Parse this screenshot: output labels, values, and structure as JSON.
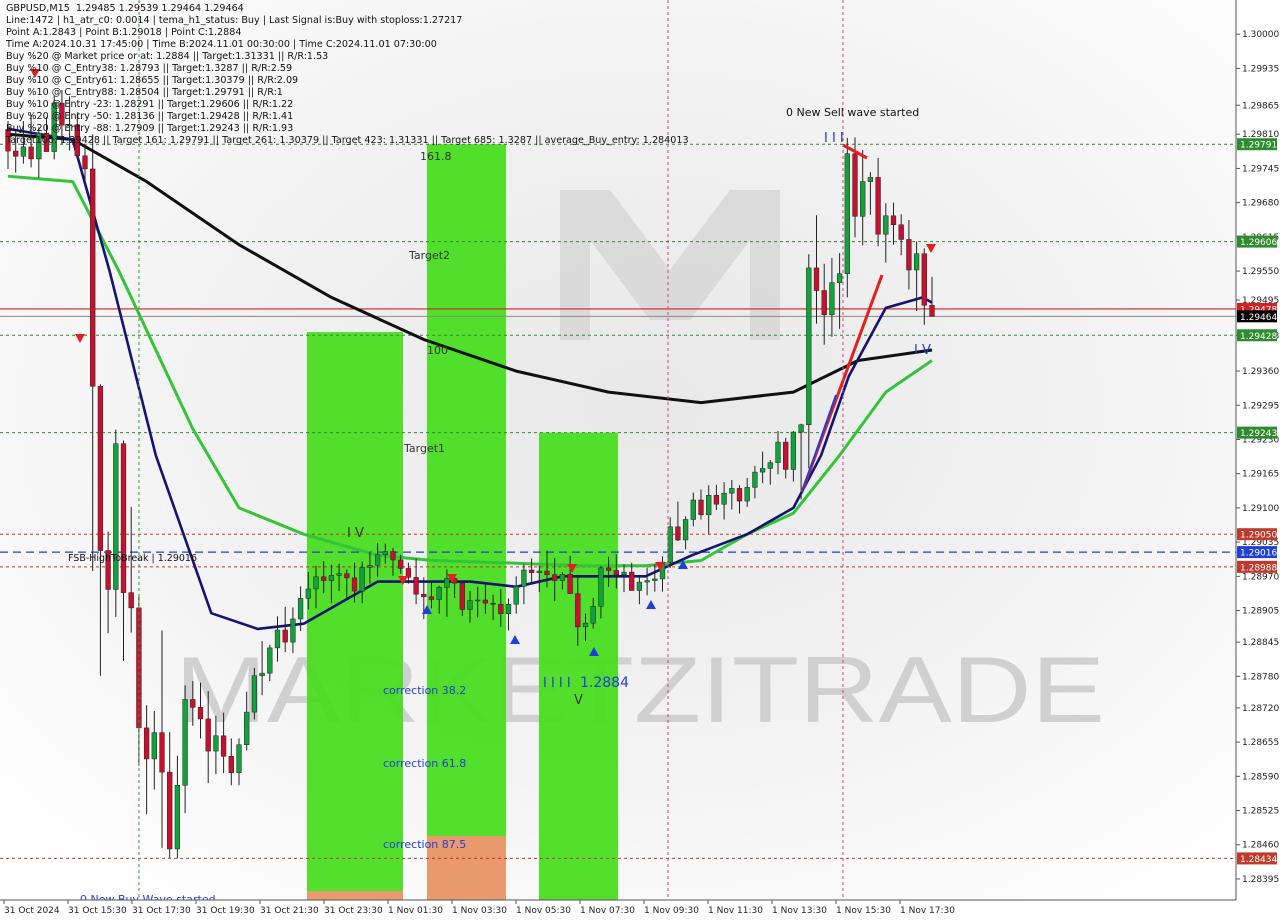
{
  "info_lines": [
    "GBPUSD,M15  1.29485 1.29539 1.29464 1.29464",
    "Line:1472 | h1_atr_c0: 0.0014 | tema_h1_status: Buy | Last Signal is:Buy with stoploss:1.27217",
    "Point A:1.2843 | Point B:1.29018 | Point C:1.2884",
    "Time A:2024.10.31 17:45:00 | Time B:2024.11.01 00:30:00 | Time C:2024.11.01 07:30:00",
    "Buy %20 @ Market price or at: 1.2884 || Target:1.31331 || R/R:1.53",
    "Buy %10 @ C_Entry38: 1.28793 || Target:1.3287 || R/R:2.59",
    "Buy %10 @ C_Entry61: 1.28655 || Target:1.30379 || R/R:2.09",
    "Buy %10 @ C_Entry88: 1.28504 || Target:1.29791 || R/R:1",
    "Buy %10 @ Entry -23: 1.28291 || Target:1.29606 || R/R:1.22",
    "Buy %20 @ Entry -50: 1.28136 || Target:1.29428 || R/R:1.41",
    "Buy %20 @ Entry -88: 1.27909 || Target:1.29243 || R/R:1.93",
    "Target100: 1.29428 || Target 161: 1.29791 || Target 261: 1.30379 || Target 423: 1.31331 || Target 685: 1.3287 || average_Buy_entry: 1.284013"
  ],
  "annotations": {
    "fsb_label": "FSB-HighToBreak | 1.29016",
    "new_sell_wave": "0 New Sell wave started",
    "new_buy_wave": "0 New Buy Wave started",
    "point_c_label": "1.2884",
    "roman_c": "I I I I",
    "roman_b": "I I I",
    "roman_v": "V",
    "roman_iv": "I V",
    "target2": "Target2",
    "target1": "Target1",
    "level_1618": "161.8",
    "level_100": "100",
    "correction_382": "correction 38.2",
    "correction_618": "correction 61.8",
    "correction_875": "correction 87.5",
    "watermark": "MARKETZITRADE"
  },
  "chart_data": {
    "type": "candlestick",
    "symbol": "GBPUSD",
    "timeframe": "M15",
    "last_price": 1.29464,
    "ylim": [
      1.28355,
      1.30065
    ],
    "y_ticks": [
      "1.30000",
      "1.29935",
      "1.29865",
      "1.29810",
      "1.29745",
      "1.29680",
      "1.29615",
      "1.29550",
      "1.29495",
      "1.29428",
      "1.29360",
      "1.29295",
      "1.29230",
      "1.29165",
      "1.29100",
      "1.29035",
      "1.28970",
      "1.28905",
      "1.28845",
      "1.28780",
      "1.28720",
      "1.28655",
      "1.28590",
      "1.28525",
      "1.28460",
      "1.28395"
    ],
    "x_labels": [
      "31 Oct 2024",
      "31 Oct 15:30",
      "31 Oct 17:30",
      "31 Oct 19:30",
      "31 Oct 21:30",
      "31 Oct 23:30",
      "1 Nov 01:30",
      "1 Nov 03:30",
      "1 Nov 05:30",
      "1 Nov 07:30",
      "1 Nov 09:30",
      "1 Nov 11:30",
      "1 Nov 13:30",
      "1 Nov 15:30",
      "1 Nov 17:30"
    ],
    "price_tags": [
      {
        "value": 1.29791,
        "text": "1.29791",
        "color": "#2e8b2e"
      },
      {
        "value": 1.29606,
        "text": "1.29606",
        "color": "#2e8b2e"
      },
      {
        "value": 1.29478,
        "text": "1.29478",
        "color": "#d42020"
      },
      {
        "value": 1.29464,
        "text": "1.29464",
        "color": "#000000"
      },
      {
        "value": 1.29428,
        "text": "1.29428",
        "color": "#2e8b2e"
      },
      {
        "value": 1.29243,
        "text": "1.29243",
        "color": "#2e8b2e"
      },
      {
        "value": 1.2905,
        "text": "1.29050",
        "color": "#c0392b"
      },
      {
        "value": 1.29016,
        "text": "1.29016",
        "color": "#1f3fd6"
      },
      {
        "value": 1.28988,
        "text": "1.28988",
        "color": "#c0392b"
      },
      {
        "value": 1.28434,
        "text": "1.28434",
        "color": "#c0392b"
      }
    ],
    "zones": [
      {
        "name": "zone-b",
        "x0": 307,
        "x1": 403,
        "top": 1.29434,
        "bottom": 1.2835,
        "color": "#44dd1a"
      },
      {
        "name": "zone-c",
        "x0": 427,
        "x1": 506,
        "top": 1.29791,
        "bottom": 1.2835,
        "color": "#44dd1a"
      },
      {
        "name": "zone-d",
        "x0": 539,
        "x1": 618,
        "top": 1.29243,
        "bottom": 1.2835,
        "color": "#44dd1a"
      }
    ],
    "colors": {
      "bull": "#11a33a",
      "bear": "#c8102e",
      "ema_black": "#111111",
      "ema_navy": "#141470",
      "ema_green": "#34c43a",
      "target_line": "#2e8b2e",
      "red_line": "#d42020",
      "blue_line": "#1f3fd6"
    },
    "candles": [
      [
        1.29819,
        1.29835,
        1.29744,
        1.29778
      ],
      [
        1.29778,
        1.29815,
        1.29737,
        1.29768
      ],
      [
        1.29768,
        1.29835,
        1.29754,
        1.29786
      ],
      [
        1.29786,
        1.29847,
        1.29747,
        1.29763
      ],
      [
        1.29763,
        1.29823,
        1.29727,
        1.29812
      ],
      [
        1.29812,
        1.29843,
        1.29786,
        1.29777
      ],
      [
        1.29777,
        1.29883,
        1.29762,
        1.29869
      ],
      [
        1.29869,
        1.29894,
        1.29791,
        1.29827
      ],
      [
        1.29827,
        1.29882,
        1.29779,
        1.29828
      ],
      [
        1.29828,
        1.29848,
        1.29789,
        1.29769
      ],
      [
        1.29769,
        1.29788,
        1.29722,
        1.29744
      ],
      [
        1.29744,
        1.2981,
        1.2898,
        1.29331
      ],
      [
        1.29331,
        1.29335,
        1.28781,
        1.29019
      ],
      [
        1.29019,
        1.29055,
        1.28862,
        1.28945
      ],
      [
        1.28945,
        1.29249,
        1.28893,
        1.29222
      ],
      [
        1.29222,
        1.29228,
        1.28809,
        1.28939
      ],
      [
        1.28939,
        1.29102,
        1.28863,
        1.2891
      ],
      [
        1.2891,
        1.28935,
        1.2861,
        1.28682
      ],
      [
        1.28682,
        1.28725,
        1.28518,
        1.28623
      ],
      [
        1.28623,
        1.28714,
        1.28565,
        1.28673
      ],
      [
        1.28673,
        1.28867,
        1.28454,
        1.28598
      ],
      [
        1.28598,
        1.28674,
        1.28435,
        1.28452
      ],
      [
        1.28452,
        1.28629,
        1.28434,
        1.28573
      ],
      [
        1.28573,
        1.28763,
        1.2852,
        1.28736
      ],
      [
        1.28736,
        1.28771,
        1.28686,
        1.28721
      ],
      [
        1.28721,
        1.28768,
        1.28662,
        1.28699
      ],
      [
        1.28699,
        1.28752,
        1.28577,
        1.28638
      ],
      [
        1.28638,
        1.28705,
        1.28594,
        1.28667
      ],
      [
        1.28667,
        1.28711,
        1.28596,
        1.28628
      ],
      [
        1.28628,
        1.28662,
        1.28573,
        1.28597
      ],
      [
        1.28597,
        1.28662,
        1.28573,
        1.2865
      ],
      [
        1.2865,
        1.28751,
        1.28639,
        1.28712
      ],
      [
        1.28712,
        1.28796,
        1.28698,
        1.28781
      ],
      [
        1.28781,
        1.28847,
        1.28744,
        1.28786
      ],
      [
        1.28786,
        1.2884,
        1.28771,
        1.28834
      ],
      [
        1.28834,
        1.28894,
        1.28808,
        1.28868
      ],
      [
        1.28868,
        1.28912,
        1.28826,
        1.28845
      ],
      [
        1.28845,
        1.28911,
        1.28824,
        1.28889
      ],
      [
        1.28889,
        1.28951,
        1.28866,
        1.28928
      ],
      [
        1.28928,
        1.28978,
        1.28907,
        1.28946
      ],
      [
        1.28946,
        1.2899,
        1.28909,
        1.28969
      ],
      [
        1.28969,
        1.28999,
        1.28938,
        1.28962
      ],
      [
        1.28962,
        1.28992,
        1.28919,
        1.28972
      ],
      [
        1.28972,
        1.28994,
        1.28942,
        1.28975
      ],
      [
        1.28975,
        1.28983,
        1.28929,
        1.28967
      ],
      [
        1.28967,
        1.28996,
        1.2892,
        1.28942
      ],
      [
        1.28942,
        1.28998,
        1.28919,
        1.28987
      ],
      [
        1.28987,
        1.29017,
        1.28956,
        1.28991
      ],
      [
        1.28991,
        1.29033,
        1.28969,
        1.29011
      ],
      [
        1.29011,
        1.29032,
        1.28994,
        1.29017
      ],
      [
        1.29017,
        1.29024,
        1.28971,
        1.29001
      ],
      [
        1.29001,
        1.29011,
        1.28975,
        1.28985
      ],
      [
        1.28985,
        1.28996,
        1.28956,
        1.28968
      ],
      [
        1.28968,
        1.29004,
        1.28917,
        1.28936
      ],
      [
        1.28936,
        1.28968,
        1.28889,
        1.28931
      ],
      [
        1.28931,
        1.28962,
        1.28909,
        1.28926
      ],
      [
        1.28926,
        1.28952,
        1.28899,
        1.28949
      ],
      [
        1.28949,
        1.28983,
        1.28893,
        1.28966
      ],
      [
        1.28966,
        1.28973,
        1.28929,
        1.28957
      ],
      [
        1.28957,
        1.2896,
        1.28895,
        1.28907
      ],
      [
        1.28907,
        1.28942,
        1.28882,
        1.28924
      ],
      [
        1.28924,
        1.2895,
        1.28892,
        1.28925
      ],
      [
        1.28925,
        1.28957,
        1.28899,
        1.28919
      ],
      [
        1.28919,
        1.28935,
        1.28887,
        1.28917
      ],
      [
        1.28917,
        1.28946,
        1.28874,
        1.28899
      ],
      [
        1.28899,
        1.28928,
        1.28867,
        1.28917
      ],
      [
        1.28917,
        1.2897,
        1.28899,
        1.28951
      ],
      [
        1.28951,
        1.28993,
        1.28917,
        1.28982
      ],
      [
        1.28982,
        1.29004,
        1.28957,
        1.28977
      ],
      [
        1.28977,
        1.2899,
        1.2894,
        1.2898
      ],
      [
        1.2898,
        1.29019,
        1.28949,
        1.28973
      ],
      [
        1.28973,
        1.29005,
        1.28923,
        1.28962
      ],
      [
        1.28962,
        1.28978,
        1.28945,
        1.28974
      ],
      [
        1.28974,
        1.29009,
        1.28953,
        1.28937
      ],
      [
        1.28937,
        1.28973,
        1.28838,
        1.28874
      ],
      [
        1.28874,
        1.28899,
        1.28847,
        1.28881
      ],
      [
        1.28881,
        1.28929,
        1.28871,
        1.28913
      ],
      [
        1.28913,
        1.28989,
        1.2889,
        1.28986
      ],
      [
        1.28986,
        1.29007,
        1.2895,
        1.28981
      ],
      [
        1.28981,
        1.29012,
        1.28947,
        1.28973
      ],
      [
        1.28973,
        1.28993,
        1.2894,
        1.28978
      ],
      [
        1.28978,
        1.28996,
        1.28947,
        1.28943
      ],
      [
        1.28943,
        1.2897,
        1.28917,
        1.28959
      ],
      [
        1.28959,
        1.28987,
        1.28934,
        1.28962
      ],
      [
        1.28962,
        1.28993,
        1.28941,
        1.28965
      ],
      [
        1.28965,
        1.29008,
        1.28941,
        1.28997
      ],
      [
        1.28997,
        1.29082,
        1.28986,
        1.29064
      ],
      [
        1.29064,
        1.29112,
        1.29037,
        1.29039
      ],
      [
        1.29039,
        1.29084,
        1.29021,
        1.29078
      ],
      [
        1.29078,
        1.29129,
        1.29065,
        1.29115
      ],
      [
        1.29115,
        1.29135,
        1.29078,
        1.29087
      ],
      [
        1.29087,
        1.29143,
        1.2905,
        1.29124
      ],
      [
        1.29124,
        1.29144,
        1.29096,
        1.29107
      ],
      [
        1.29107,
        1.29149,
        1.29078,
        1.29128
      ],
      [
        1.29128,
        1.29153,
        1.29097,
        1.29137
      ],
      [
        1.29137,
        1.29143,
        1.29089,
        1.29113
      ],
      [
        1.29113,
        1.29157,
        1.29102,
        1.29139
      ],
      [
        1.29139,
        1.2918,
        1.29118,
        1.29168
      ],
      [
        1.29168,
        1.29207,
        1.29147,
        1.29175
      ],
      [
        1.29175,
        1.29191,
        1.29144,
        1.29186
      ],
      [
        1.29186,
        1.29246,
        1.29164,
        1.29225
      ],
      [
        1.29225,
        1.29233,
        1.29156,
        1.29173
      ],
      [
        1.29173,
        1.29246,
        1.2915,
        1.29244
      ],
      [
        1.29244,
        1.2926,
        1.29116,
        1.29258
      ],
      [
        1.29258,
        1.29582,
        1.29175,
        1.29556
      ],
      [
        1.29556,
        1.29656,
        1.2945,
        1.29513
      ],
      [
        1.29513,
        1.29564,
        1.2941,
        1.29467
      ],
      [
        1.29467,
        1.29575,
        1.29425,
        1.29528
      ],
      [
        1.29528,
        1.29584,
        1.2944,
        1.29545
      ],
      [
        1.29545,
        1.29803,
        1.295,
        1.29773
      ],
      [
        1.29773,
        1.29804,
        1.29614,
        1.29654
      ],
      [
        1.29654,
        1.2978,
        1.29599,
        1.2972
      ],
      [
        1.2972,
        1.29738,
        1.29657,
        1.29728
      ],
      [
        1.29728,
        1.29765,
        1.29597,
        1.2962
      ],
      [
        1.2962,
        1.29679,
        1.29566,
        1.29655
      ],
      [
        1.29655,
        1.2968,
        1.296,
        1.29638
      ],
      [
        1.29638,
        1.29658,
        1.2958,
        1.2961
      ],
      [
        1.2961,
        1.29647,
        1.29515,
        1.29552
      ],
      [
        1.29552,
        1.29606,
        1.29474,
        1.29583
      ],
      [
        1.29583,
        1.29593,
        1.29448,
        1.29485
      ],
      [
        1.29485,
        1.29539,
        1.29464,
        1.29464
      ]
    ],
    "ema_black": [
      [
        0,
        1.2981
      ],
      [
        0.07,
        1.298
      ],
      [
        0.15,
        1.2972
      ],
      [
        0.25,
        1.296
      ],
      [
        0.35,
        1.295
      ],
      [
        0.45,
        1.2942
      ],
      [
        0.55,
        1.2936
      ],
      [
        0.65,
        1.2932
      ],
      [
        0.75,
        1.293
      ],
      [
        0.85,
        1.2932
      ],
      [
        0.92,
        1.2938
      ],
      [
        1,
        1.294
      ]
    ],
    "ema_navy": [
      [
        0,
        1.2982
      ],
      [
        0.07,
        1.298
      ],
      [
        0.11,
        1.2955
      ],
      [
        0.16,
        1.292
      ],
      [
        0.22,
        1.289
      ],
      [
        0.27,
        1.2887
      ],
      [
        0.32,
        1.2888
      ],
      [
        0.4,
        1.2896
      ],
      [
        0.5,
        1.2896
      ],
      [
        0.55,
        1.2895
      ],
      [
        0.6,
        1.2897
      ],
      [
        0.69,
        1.2897
      ],
      [
        0.74,
        1.2901
      ],
      [
        0.8,
        1.2905
      ],
      [
        0.85,
        1.291
      ],
      [
        0.88,
        1.292
      ],
      [
        0.91,
        1.2935
      ],
      [
        0.95,
        1.2948
      ],
      [
        0.99,
        1.295
      ],
      [
        1,
        1.2949
      ]
    ],
    "ema_green": [
      [
        0,
        1.2973
      ],
      [
        0.07,
        1.2972
      ],
      [
        0.12,
        1.2955
      ],
      [
        0.2,
        1.2925
      ],
      [
        0.25,
        1.291
      ],
      [
        0.32,
        1.2905
      ],
      [
        0.4,
        1.2901
      ],
      [
        0.46,
        1.29
      ],
      [
        0.55,
        1.28995
      ],
      [
        0.62,
        1.2899
      ],
      [
        0.69,
        1.2899
      ],
      [
        0.75,
        1.29
      ],
      [
        0.8,
        1.2905
      ],
      [
        0.85,
        1.2909
      ],
      [
        0.9,
        1.292
      ],
      [
        0.95,
        1.2932
      ],
      [
        1,
        1.2938
      ]
    ],
    "fsb_value": 1.29016,
    "dotted_levels": [
      1.29791,
      1.29606,
      1.29428,
      1.29243,
      1.2905,
      1.28988,
      1.28434
    ]
  }
}
